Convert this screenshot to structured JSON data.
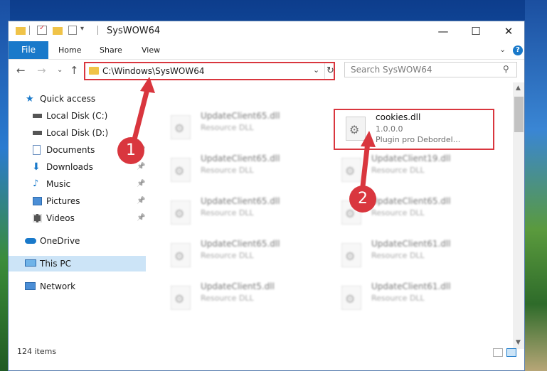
{
  "window": {
    "title": "SysWOW64",
    "minimize_glyph": "—",
    "maximize_glyph": "☐",
    "close_glyph": "✕"
  },
  "ribbon": {
    "tabs": [
      "File",
      "Home",
      "Share",
      "View"
    ],
    "help_glyph": "?",
    "expand_glyph": "⌄"
  },
  "nav": {
    "back_glyph": "←",
    "forward_glyph": "→",
    "recent_glyph": "⌄",
    "up_glyph": "↑",
    "address": "C:\\Windows\\SysWOW64",
    "address_dropdown_glyph": "⌄",
    "refresh_glyph": "↻",
    "search_placeholder": "Search SysWOW64",
    "search_glyph": "⚲"
  },
  "sidebar": {
    "items": [
      {
        "label": "Quick access",
        "icon": "star-icon"
      },
      {
        "label": "Local Disk (C:)",
        "icon": "drive-icon"
      },
      {
        "label": "Local Disk (D:)",
        "icon": "drive-icon"
      },
      {
        "label": "Documents",
        "icon": "documents-icon"
      },
      {
        "label": "Downloads",
        "icon": "download-icon"
      },
      {
        "label": "Music",
        "icon": "music-icon"
      },
      {
        "label": "Pictures",
        "icon": "pictures-icon"
      },
      {
        "label": "Videos",
        "icon": "videos-icon"
      },
      {
        "label": "OneDrive",
        "icon": "cloud-icon"
      },
      {
        "label": "This PC",
        "icon": "computer-icon"
      },
      {
        "label": "Network",
        "icon": "network-icon"
      }
    ],
    "pin_glyph": "📌"
  },
  "files": {
    "highlighted": {
      "name": "cookies.dll",
      "version": "1.0.0.0",
      "description": "Plugin pro Debordel..."
    },
    "blurred": [
      {
        "name": "UpdateClient65.dll",
        "type": "Resource DLL"
      },
      {
        "name": "UpdateClient65.dll",
        "type": "Resource DLL"
      },
      {
        "name": "UpdateClient19.dll",
        "type": "Resource DLL"
      },
      {
        "name": "UpdateClient65.dll",
        "type": "Resource DLL"
      },
      {
        "name": "UpdateClient65.dll",
        "type": "Resource DLL"
      },
      {
        "name": "UpdateClient65.dll",
        "type": "Resource DLL"
      },
      {
        "name": "UpdateClient61.dll",
        "type": "Resource DLL"
      },
      {
        "name": "UpdateClient5.dll",
        "type": "Resource DLL"
      },
      {
        "name": "UpdateClient61.dll",
        "type": "Resource DLL"
      }
    ]
  },
  "status": {
    "item_count": "124 items"
  },
  "callouts": [
    "1",
    "2"
  ],
  "colors": {
    "accent": "#1979ca",
    "annotation_red": "#d9363e",
    "selected_nav": "#cce4f7"
  }
}
